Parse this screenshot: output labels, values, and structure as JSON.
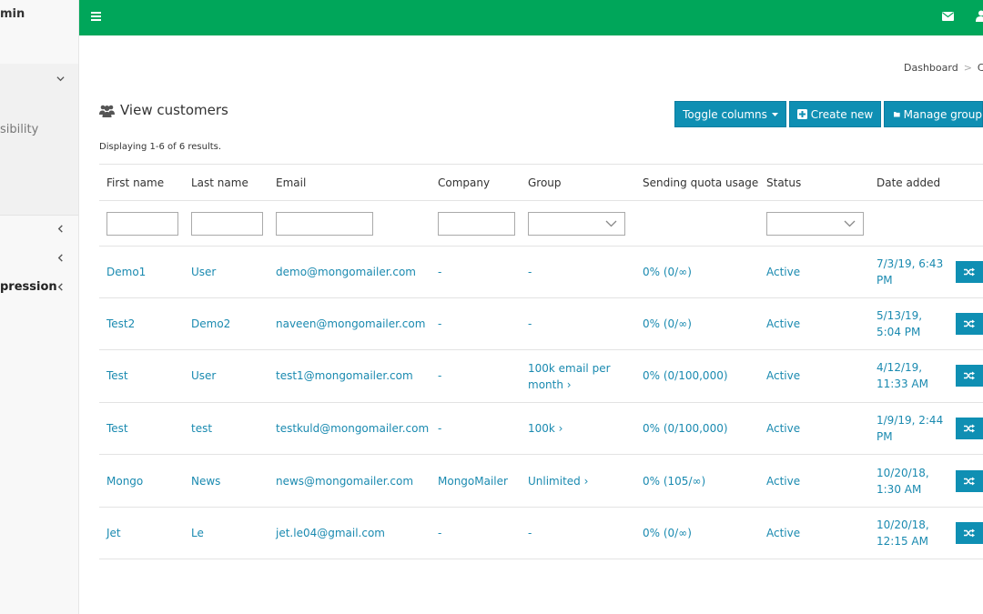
{
  "sidebar": {
    "brand": "min",
    "items": [
      {
        "label": "sibility"
      },
      {
        "label": "pression"
      }
    ]
  },
  "breadcrumb": {
    "home": "Dashboard",
    "separator": ">",
    "current": "Cu"
  },
  "page": {
    "title": "View customers",
    "summary": "Displaying 1-6 of 6 results."
  },
  "toolbar": {
    "toggle_columns": "Toggle columns",
    "create_new": "Create new",
    "manage_groups": "Manage group"
  },
  "table": {
    "headers": [
      "First name",
      "Last name",
      "Email",
      "Company",
      "Group",
      "Sending quota usage",
      "Status",
      "Date added"
    ],
    "rows": [
      {
        "first": "Demo1",
        "last": "User",
        "email": "demo@mongomailer.com",
        "company": "-",
        "group": "-",
        "quota": "0% (0/∞)",
        "status": "Active",
        "date1": "7/3/19, 6:43",
        "date2": "PM"
      },
      {
        "first": "Test2",
        "last": "Demo2",
        "email": "naveen@mongomailer.com",
        "company": "-",
        "group": "-",
        "quota": "0% (0/∞)",
        "status": "Active",
        "date1": "5/13/19,",
        "date2": "5:04 PM"
      },
      {
        "first": "Test",
        "last": "User",
        "email": "test1@mongomailer.com",
        "company": "-",
        "group": "100k email per month ›",
        "quota": "0% (0/100,000)",
        "status": "Active",
        "date1": "4/12/19,",
        "date2": "11:33 AM"
      },
      {
        "first": "Test",
        "last": "test",
        "email": "testkuld@mongomailer.com",
        "company": "-",
        "group": "100k ›",
        "quota": "0% (0/100,000)",
        "status": "Active",
        "date1": "1/9/19, 2:44",
        "date2": "PM"
      },
      {
        "first": "Mongo",
        "last": "News",
        "email": "news@mongomailer.com",
        "company": "MongoMailer",
        "group": "Unlimited ›",
        "quota": "0% (105/∞)",
        "status": "Active",
        "date1": "10/20/18,",
        "date2": "1:30 AM"
      },
      {
        "first": "Jet",
        "last": "Le",
        "email": "jet.le04@gmail.com",
        "company": "-",
        "group": "-",
        "quota": "0% (0/∞)",
        "status": "Active",
        "date1": "10/20/18,",
        "date2": "12:15 AM"
      }
    ]
  },
  "icons": {
    "menu": "hamburger-icon",
    "mail": "envelope-icon",
    "user": "user-icon",
    "users": "users-icon",
    "plus": "plus-square-icon",
    "folder": "folder-icon",
    "switch": "random-icon"
  },
  "colors": {
    "topbar": "#00a65a",
    "button": "#0f8fb3",
    "link": "#1a8ab0"
  }
}
